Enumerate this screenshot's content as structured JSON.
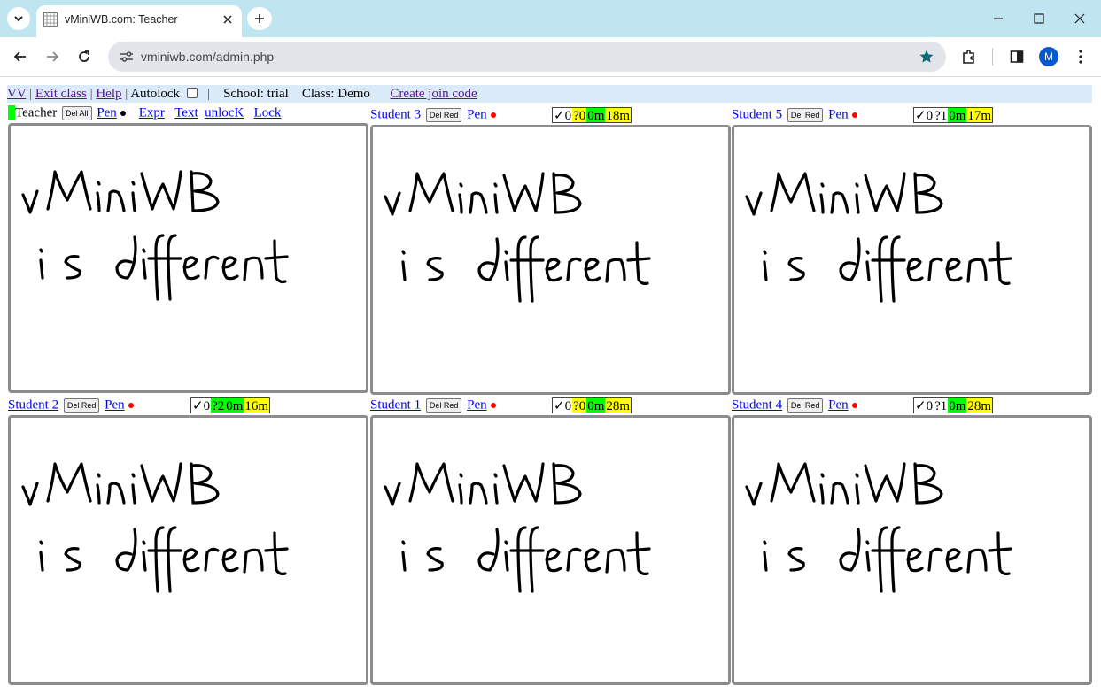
{
  "browser": {
    "tab_title": "vMiniWB.com: Teacher",
    "url": "vminiwb.com/admin.php",
    "profile_initial": "M"
  },
  "topbar": {
    "vv": "VV",
    "exit_class": "Exit class",
    "help": "Help",
    "autolock": "Autolock",
    "school": "School: trial",
    "class": "Class: Demo",
    "create_join_code": "Create join code",
    "divider": "|"
  },
  "teacher_panel": {
    "name": "Teacher",
    "del_all": "Del All",
    "pen": "Pen",
    "expr": "Expr",
    "text": "Text",
    "unlock": "unlocK",
    "lock": "Lock"
  },
  "student_panels": [
    {
      "name": "Student 3",
      "del_label": "Del Red",
      "pen": "Pen",
      "stats": [
        "✓0",
        "?0",
        "0m",
        "18m"
      ]
    },
    {
      "name": "Student 5",
      "del_label": "Del Red",
      "pen": "Pen",
      "stats": [
        "✓0",
        "?1",
        "0m",
        "17m"
      ]
    },
    {
      "name": "Student 2",
      "del_label": "Del Red",
      "pen": "Pen",
      "stats": [
        "✓0",
        "?2",
        "0m",
        "16m"
      ]
    },
    {
      "name": "Student 1",
      "del_label": "Del Red",
      "pen": "Pen",
      "stats": [
        "✓0",
        "?0",
        "0m",
        "28m"
      ]
    },
    {
      "name": "Student 4",
      "del_label": "Del Red",
      "pen": "Pen",
      "stats": [
        "✓0",
        "?1",
        "0m",
        "28m"
      ]
    }
  ],
  "board_text": {
    "line1": "vMiniWB",
    "line2": "is different"
  },
  "colors": {
    "stat_green": "#00ff00",
    "stat_yellow": "#ffff00",
    "pen_red": "#ff0000",
    "board_border": "#8c8c8c",
    "topbar_bg": "#dbeaf9"
  }
}
